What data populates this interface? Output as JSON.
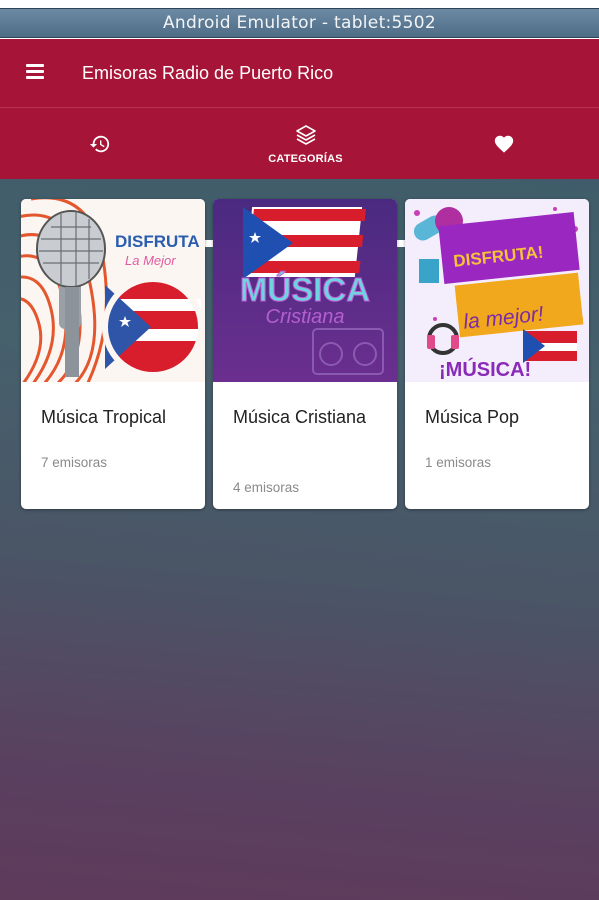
{
  "emulator": {
    "title": "Android Emulator - tablet:5502"
  },
  "toolbar": {
    "title": "Emisoras Radio de Puerto Rico"
  },
  "tabs": [
    {
      "icon": "history-icon",
      "label": ""
    },
    {
      "icon": "layers-icon",
      "label": "CATEGORÍAS"
    },
    {
      "icon": "heart-icon",
      "label": ""
    }
  ],
  "categories": [
    {
      "title": "Música Tropical",
      "count": "7 emisoras",
      "image_text": {
        "line1": "DISFRUTA",
        "line2": "La Mejor"
      }
    },
    {
      "title": "Música Cristiana",
      "count": "4 emisoras",
      "image_text": {
        "line1": "MÚSICA",
        "line2": "Cristiana"
      }
    },
    {
      "title": "Música Pop",
      "count": "1 emisoras",
      "image_text": {
        "line1": "DISFRUTA!",
        "line2": "la mejor!",
        "line3": "¡MÚSICA!"
      }
    }
  ],
  "colors": {
    "primary": "#a61537",
    "indicator": "#ffffff"
  }
}
